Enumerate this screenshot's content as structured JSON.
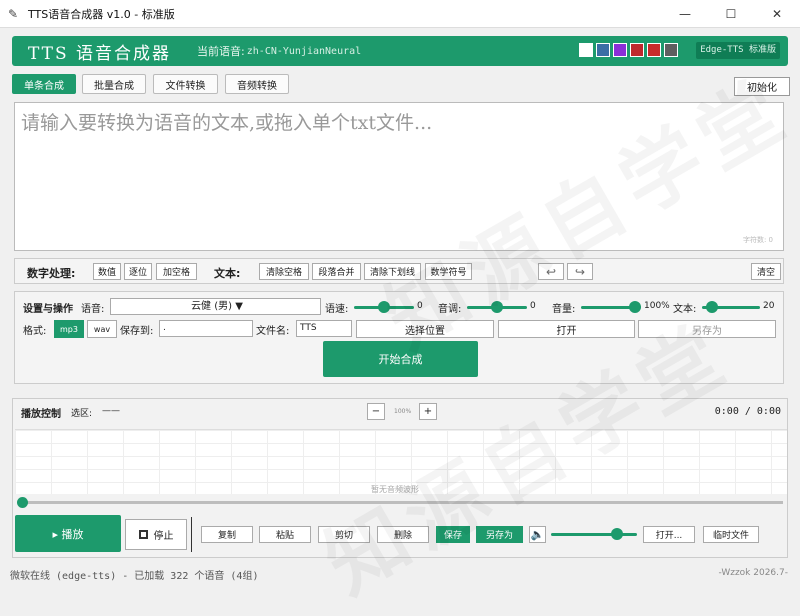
{
  "window": {
    "title": "TTS语音合成器 v1.0 - 标准版",
    "minimize": "—",
    "maximize": "☐",
    "close": "✕",
    "app_icon": "feather-icon"
  },
  "header": {
    "app_title": "TTS 语音合成器",
    "current_voice_label": "当前语音:",
    "current_voice": "zh-CN-YunjianNeural",
    "theme_colors": [
      "#ffffff",
      "#3b6ea5",
      "#8b2fd6",
      "#c0282d",
      "#c72b2b",
      "#5f5f5f"
    ],
    "engine_badge": "Edge-TTS 标准版",
    "brand_color": "#1d9a6c"
  },
  "tabs": [
    {
      "label": "单条合成",
      "active": true
    },
    {
      "label": "批量合成",
      "active": false
    },
    {
      "label": "文件转换",
      "active": false
    },
    {
      "label": "音频转换",
      "active": false
    }
  ],
  "init_button": "初始化",
  "text_input": {
    "placeholder": "请输入要转换为语音的文本,或拖入单个txt文件...",
    "char_count": "字符数: 0"
  },
  "tools": {
    "number_label": "数字处理:",
    "number_buttons": [
      "数值",
      "逐位",
      "加空格"
    ],
    "text_label": "文本:",
    "text_buttons": [
      "清除空格",
      "段落合并",
      "清除下划线",
      "数学符号"
    ],
    "undo": "↩",
    "redo": "↪",
    "clear": "清空"
  },
  "settings": {
    "section_label": "设置与操作",
    "voice_label": "语音:",
    "voice_value": "云健 (男) ▼",
    "rate_label": "语速:",
    "rate_value": "0",
    "pitch_label": "音调:",
    "pitch_value": "0",
    "volume_label": "音量:",
    "volume_value": "100%",
    "text_label": "文本:",
    "text_value": "20",
    "format_label": "格式:",
    "format_mp3": "mp3",
    "format_wav": "wav",
    "save_to_label": "保存到:",
    "save_to_value": ".",
    "filename_label": "文件名:",
    "filename_value": "TTS",
    "choose_location": "选择位置",
    "open": "打开",
    "save_as": "另存为",
    "start": "开始合成"
  },
  "playback": {
    "label": "播放控制",
    "selection_label": "选区:",
    "selection_value": "——",
    "zoom_out": "−",
    "zoom_value": "100%",
    "zoom_in": "+",
    "time": "0:00 / 0:00",
    "no_wave": "暂无音频波形",
    "play": "▸ 播放",
    "stop": "停止",
    "buttons": [
      "复制",
      "粘贴",
      "剪切",
      "删除"
    ],
    "save": "保存",
    "save_as": "另存为",
    "open": "打开...",
    "temp_file": "临时文件",
    "volume_level": 0.88
  },
  "status": {
    "text": "微软在线 (edge-tts) - 已加载 322 个语音 (4组)",
    "copyright": "-Wzzok 2026.7-"
  },
  "watermark": "知源自学堂"
}
